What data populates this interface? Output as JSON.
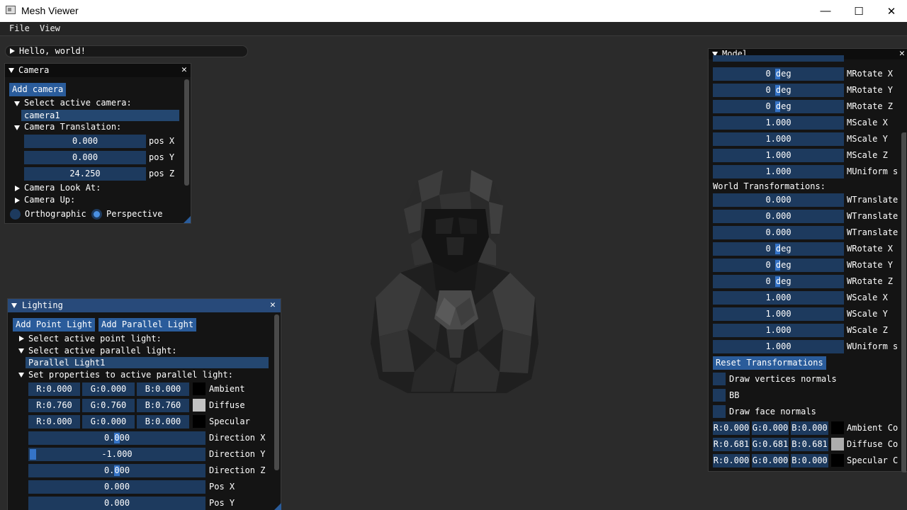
{
  "window": {
    "title": "Mesh Viewer"
  },
  "menu": {
    "file": "File",
    "view": "View"
  },
  "hello": {
    "label": "Hello, world!"
  },
  "camera": {
    "title": "Camera",
    "add_button": "Add camera",
    "select_label": "Select active camera:",
    "selected": "camera1",
    "translation_label": "Camera Translation:",
    "pos_x": "0.000",
    "pos_x_label": "pos X",
    "pos_y": "0.000",
    "pos_y_label": "pos Y",
    "pos_z": "24.250",
    "pos_z_label": "pos Z",
    "look_at_label": "Camera Look At:",
    "up_label": "Camera Up:",
    "ortho_label": "Orthographic",
    "persp_label": "Perspective",
    "projection": "Perspective"
  },
  "lighting": {
    "title": "Lighting",
    "add_point": "Add Point Light",
    "add_parallel": "Add Parallel Light",
    "select_point_label": "Select active point light:",
    "select_parallel_label": "Select active parallel light:",
    "selected_parallel": "Parallel Light1",
    "props_label": "Set properties to active parallel light:",
    "ambient": {
      "r": "R:0.000",
      "g": "G:0.000",
      "b": "B:0.000",
      "label": "Ambient",
      "color": "#000000"
    },
    "diffuse": {
      "r": "R:0.760",
      "g": "G:0.760",
      "b": "B:0.760",
      "label": "Diffuse",
      "color": "#c2c2c2"
    },
    "specular": {
      "r": "R:0.000",
      "g": "G:0.000",
      "b": "B:0.000",
      "label": "Specular",
      "color": "#000000"
    },
    "dir_x": {
      "value": "0.000",
      "label": "Direction X"
    },
    "dir_y": {
      "value": "-1.000",
      "label": "Direction Y"
    },
    "dir_z": {
      "value": "0.000",
      "label": "Direction Z"
    },
    "pos_x": {
      "value": "0.000",
      "label": "Pos X"
    },
    "pos_y": {
      "value": "0.000",
      "label": "Pos Y"
    }
  },
  "model": {
    "title": "Model",
    "model_rows": [
      {
        "value": "0 deg",
        "label": "MRotate X"
      },
      {
        "value": "0 deg",
        "label": "MRotate Y"
      },
      {
        "value": "0 deg",
        "label": "MRotate Z"
      },
      {
        "value": "1.000",
        "label": "MScale X"
      },
      {
        "value": "1.000",
        "label": "MScale Y"
      },
      {
        "value": "1.000",
        "label": "MScale Z"
      },
      {
        "value": "1.000",
        "label": "MUniform s"
      }
    ],
    "world_label": "World Transformations:",
    "world_rows": [
      {
        "value": "0.000",
        "label": "WTranslate"
      },
      {
        "value": "0.000",
        "label": "WTranslate"
      },
      {
        "value": "0.000",
        "label": "WTranslate"
      },
      {
        "value": "0 deg",
        "label": "WRotate X"
      },
      {
        "value": "0 deg",
        "label": "WRotate Y"
      },
      {
        "value": "0 deg",
        "label": "WRotate Z"
      },
      {
        "value": "1.000",
        "label": "WScale X"
      },
      {
        "value": "1.000",
        "label": "WScale Y"
      },
      {
        "value": "1.000",
        "label": "WScale Z"
      },
      {
        "value": "1.000",
        "label": "WUniform s"
      }
    ],
    "reset_button": "Reset Transformations",
    "draw_vertex_normals": "Draw vertices normals",
    "bb": "BB",
    "draw_face_normals": "Draw face normals",
    "ambient": {
      "r": "R:0.000",
      "g": "G:0.000",
      "b": "B:0.000",
      "label": "Ambient Co",
      "color": "#000000"
    },
    "diffuse": {
      "r": "R:0.681",
      "g": "G:0.681",
      "b": "B:0.681",
      "label": "Diffuse Co",
      "color": "#adadad"
    },
    "specular": {
      "r": "R:0.000",
      "g": "G:0.000",
      "b": "B:0.000",
      "label": "Specular C",
      "color": "#000000"
    }
  }
}
